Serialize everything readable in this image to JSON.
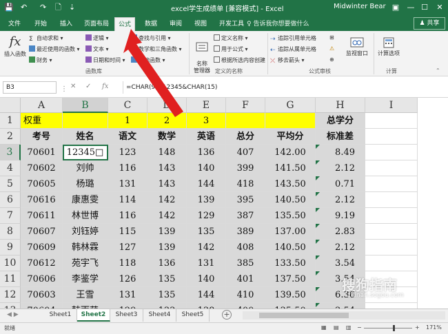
{
  "titlebar": {
    "title": "excel学生成绩单 [兼容模式] - Excel",
    "user": "Midwinter Bear",
    "qa_save": "💾",
    "qa_undo": "↶",
    "qa_redo": "↷",
    "qa_new": "🗋",
    "qa_more": "⇣",
    "ribbon_opts": "▣",
    "min": "—",
    "max": "☐",
    "close": "✕"
  },
  "tabs": [
    "文件",
    "开始",
    "插入",
    "页面布局",
    "公式",
    "数据",
    "审阅",
    "视图",
    "开发工具"
  ],
  "active_tab": "公式",
  "tellme": "♀ 告诉我你想要做什么",
  "share": "♟ 共享",
  "ribbon": {
    "insert_function": "插入函数",
    "fx_symbol": "fx",
    "autosum": "自动求和 ▾",
    "recent": "最近使用的函数 ▾",
    "financial": "财务 ▾",
    "logical": "逻辑 ▾",
    "text": "文本 ▾",
    "datetime": "日期和时间 ▾",
    "lookup": "查找与引用 ▾",
    "math": "数学和三角函数 ▾",
    "other": "其他函数 ▾",
    "function_library": "函数库",
    "name_manager": "名称\n管理器",
    "define_name": "定义名称 ▾",
    "use_in_formula": "用于公式 ▾",
    "create_from_sel": "根据所选内容创建",
    "defined_names": "定义的名称",
    "trace_precedents": "追踪引用单元格",
    "trace_dependents": "追踪从属单元格",
    "remove_arrows": "移去箭头 ▾",
    "show_formulas": "⊞",
    "error_check": "⚠",
    "eval_formula": "⊕",
    "formula_auditing": "公式审核",
    "watch_window": "监视窗口",
    "calc_options": "计算选项",
    "calculation": "计算"
  },
  "namebox": "B3",
  "fb_cancel": "✕",
  "fb_enter": "✓",
  "fb_fx": "fx",
  "formula": "=CHAR(9)&12345&CHAR(15)",
  "columns": [
    "A",
    "B",
    "C",
    "D",
    "E",
    "F",
    "G",
    "H",
    "I"
  ],
  "rows": [
    "1",
    "2",
    "3",
    "4",
    "5",
    "6",
    "7",
    "8",
    "9",
    "10",
    "11",
    "12",
    "13"
  ],
  "row1": {
    "a": "权重",
    "c": "1",
    "d": "2",
    "e": "3",
    "h": "总学分"
  },
  "row2": [
    "考号",
    "姓名",
    "语文",
    "数学",
    "英语",
    "总分",
    "平均分",
    "标准差"
  ],
  "data": [
    [
      "70601",
      "12345□",
      "123",
      "148",
      "136",
      "407",
      "142.00",
      "8.49"
    ],
    [
      "70602",
      "刘帅",
      "116",
      "143",
      "140",
      "399",
      "141.50",
      "2.12"
    ],
    [
      "70605",
      "杨璐",
      "131",
      "143",
      "144",
      "418",
      "143.50",
      "0.71"
    ],
    [
      "70616",
      "康惠雯",
      "114",
      "142",
      "139",
      "395",
      "140.50",
      "2.12"
    ],
    [
      "70611",
      "林世博",
      "116",
      "142",
      "129",
      "387",
      "135.50",
      "9.19"
    ],
    [
      "70607",
      "刘钰婷",
      "115",
      "139",
      "135",
      "389",
      "137.00",
      "2.83"
    ],
    [
      "70609",
      "韩林霖",
      "127",
      "139",
      "142",
      "408",
      "140.50",
      "2.12"
    ],
    [
      "70612",
      "苑宇飞",
      "118",
      "136",
      "131",
      "385",
      "133.50",
      "3.54"
    ],
    [
      "70606",
      "李鉴学",
      "126",
      "135",
      "140",
      "401",
      "137.50",
      "3.54"
    ],
    [
      "70603",
      "王雪",
      "131",
      "135",
      "144",
      "410",
      "139.50",
      "6.36"
    ],
    [
      "70604",
      "韩雨萌",
      "129",
      "133",
      "138",
      "400",
      "135.50",
      "3.54"
    ]
  ],
  "sheets": [
    "Sheet1",
    "Sheet2",
    "Sheet3",
    "Sheet4",
    "Sheet5"
  ],
  "active_sheet": "Sheet2",
  "sheet_nav": "◀ ▶",
  "add_sheet": "+",
  "status": {
    "ready": "就绪",
    "view_normal": "▦",
    "view_layout": "▤",
    "view_break": "▥",
    "zoom_minus": "−",
    "zoom_plus": "+",
    "zoom": "171%"
  },
  "watermark": "搜狗指南",
  "watermark_url": "zhinan.sogou.com",
  "colors": {
    "excel_green": "#217346",
    "yellow": "#ffff00",
    "gray_fill": "#d9d9d9",
    "arrow_red": "#e02020"
  }
}
